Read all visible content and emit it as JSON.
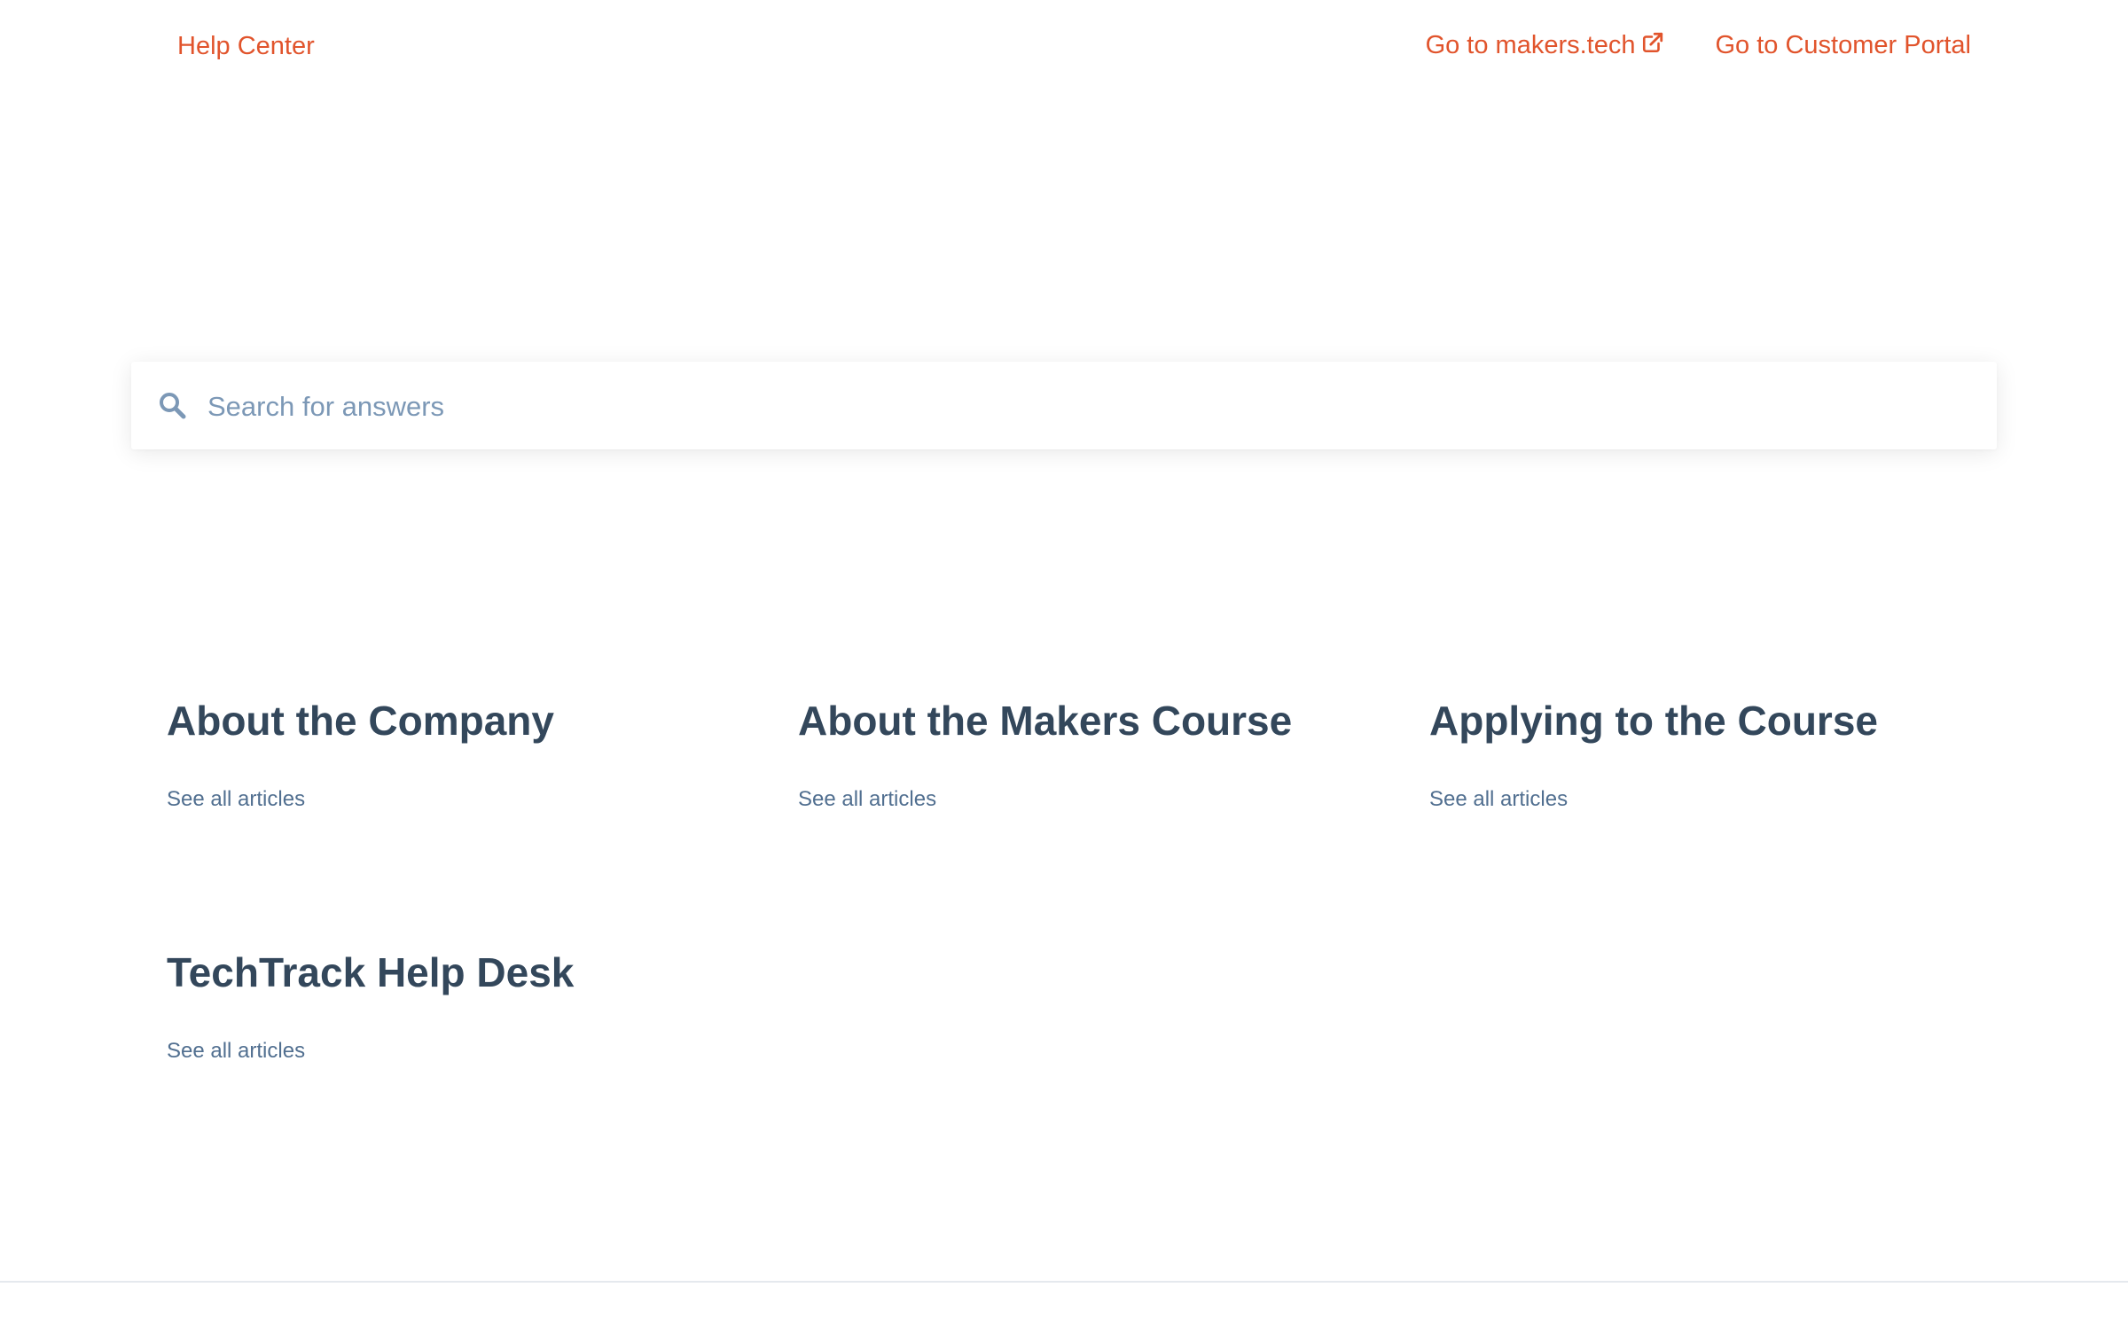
{
  "header": {
    "brand": "Help Center",
    "links": [
      {
        "label": "Go to makers.tech",
        "external": true
      },
      {
        "label": "Go to Customer Portal",
        "external": false
      }
    ]
  },
  "search": {
    "placeholder": "Search for answers",
    "value": "",
    "icon": "search-icon"
  },
  "categories": [
    {
      "title": "About the Company",
      "link": "See all articles"
    },
    {
      "title": "About the Makers Course",
      "link": "See all articles"
    },
    {
      "title": "Applying to the Course",
      "link": "See all articles"
    },
    {
      "title": "TechTrack Help Desk",
      "link": "See all articles"
    }
  ],
  "colors": {
    "accent": "#e1542c",
    "heading": "#33475b",
    "link": "#516f90",
    "placeholder": "#7c98b6"
  }
}
